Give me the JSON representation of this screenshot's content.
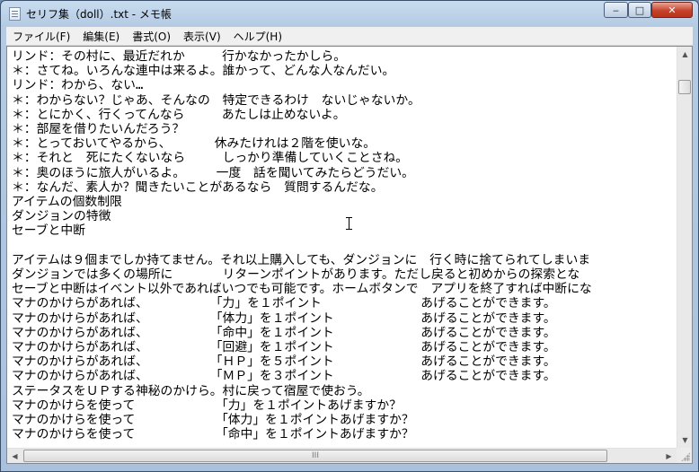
{
  "window": {
    "title": "セリフ集（doll）.txt - メモ帳",
    "controls": {
      "minimize": "‒",
      "maximize": "□",
      "close": "✕"
    }
  },
  "menu": [
    "ファイル(F)",
    "編集(E)",
    "書式(O)",
    "表示(V)",
    "ヘルプ(H)"
  ],
  "editor": {
    "lines": [
      "リンド：その村に、最近だれか　　　行かなかったかしら。",
      "＊：さてね。いろんな連中は来るよ。誰かって、どんな人なんだい。",
      "リンド：わから、ない…",
      "＊：わからない？じゃあ、そんなの　特定できるわけ　ないじゃないか。",
      "＊：とにかく、行くってんなら　　　あたしは止めないよ。",
      "＊：部屋を借りたいんだろう？",
      "＊：とっておいてやるから、　　　　休みたけれは２階を使いな。",
      "＊：それと　死にたくないなら　　　しっかり準備していくことさね。",
      "＊：奥のほうに旅人がいるよ。　　　一度　話を聞いてみたらどうだい。",
      "＊：なんだ、素人か？聞きたいことがあるなら　質問するんだな。",
      "アイテムの個数制限",
      "ダンジョンの特徴",
      "セーブと中断",
      "",
      "アイテムは９個までしか持てません。それ以上購入しても、ダンジョンに　行く時に捨てられてしまいま",
      "ダンジョンでは多くの場所に　　　　リターンポイントがあります。ただし戻ると初めからの探索とな",
      "セーブと中断はイベント以外であればいつでも可能です。ホームボタンで　アプリを終了すれば中断にな",
      "マナのかけらがあれば、　　　　　　「力」を１ポイント　　　　　　　　あげることができます。",
      "マナのかけらがあれば、　　　　　　「体力」を１ポイント　　　　　　　あげることができます。",
      "マナのかけらがあれば、　　　　　　「命中」を１ポイント　　　　　　　あげることができます。",
      "マナのかけらがあれば、　　　　　　「回避」を１ポイント　　　　　　　あげることができます。",
      "マナのかけらがあれば、　　　　　　「ＨＰ」を５ポイント　　　　　　　あげることができます。",
      "マナのかけらがあれば、　　　　　　「ＭＰ」を３ポイント　　　　　　　あげることができます。",
      "ステータスをＵＰする神秘のかけら。村に戻って宿屋で使おう。",
      "マナのかけらを使って　　　　　　　「力」を１ポイントあげますか？",
      "マナのかけらを使って　　　　　　　「体力」を１ポイントあげますか？",
      "マナのかけらを使って　　　　　　　「命中」を１ポイントあげますか？"
    ]
  },
  "scrollbar": {
    "horizontal_thumb_grip": "III",
    "up_arrow": "▲",
    "down_arrow": "▼",
    "left_arrow": "◀",
    "right_arrow": "▶"
  }
}
